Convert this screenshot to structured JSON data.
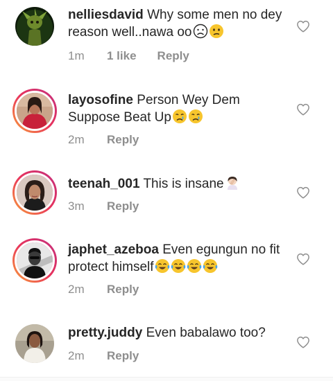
{
  "comments": [
    {
      "username": "nelliesdavid",
      "text": "Why some men no dey reason well..nawa oo",
      "emojis": [
        "frowning-face",
        "confused-face"
      ],
      "time": "1m",
      "likes": "1 like",
      "reply": "Reply",
      "avatar": "plant-character-avatar",
      "story_ring": false
    },
    {
      "username": "layosofine",
      "text": "Person Wey Dem Suppose Beat Up",
      "emojis": [
        "crying-face",
        "crying-face"
      ],
      "time": "2m",
      "likes": "",
      "reply": "Reply",
      "avatar": "woman-red-top-avatar",
      "story_ring": true
    },
    {
      "username": "teenah_001",
      "text": "This is insane",
      "emojis": [
        "facepalm-woman"
      ],
      "time": "3m",
      "likes": "",
      "reply": "Reply",
      "avatar": "woman-portrait-avatar",
      "story_ring": true
    },
    {
      "username": "japhet_azeboa",
      "text": "Even egungun no fit protect himself",
      "emojis": [
        "tears-of-joy",
        "tears-of-joy",
        "tears-of-joy",
        "tears-of-joy"
      ],
      "time": "2m",
      "likes": "",
      "reply": "Reply",
      "avatar": "man-black-white-avatar",
      "story_ring": true
    },
    {
      "username": "pretty.juddy",
      "text": "Even babalawo too?",
      "emojis": [],
      "time": "2m",
      "likes": "",
      "reply": "Reply",
      "avatar": "woman-white-dress-avatar",
      "story_ring": false
    }
  ],
  "colors": {
    "text": "#262626",
    "meta": "#8e8e8e",
    "ring_start": "#f9a13a",
    "ring_end": "#c2307f"
  }
}
